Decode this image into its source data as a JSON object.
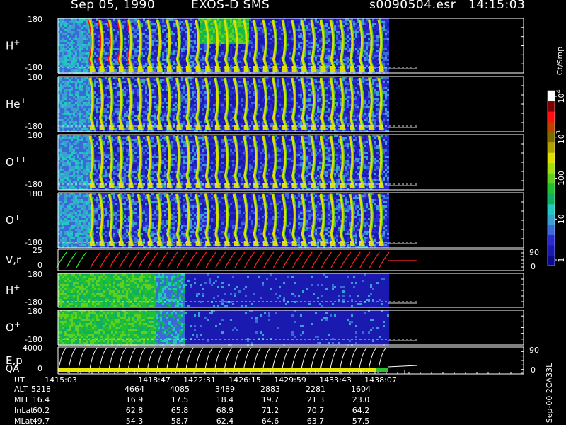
{
  "header": {
    "date": "Sep 05, 1990",
    "instrument": "EXOS-D SMS",
    "file": "s0090504.esr",
    "time": "14:15:03"
  },
  "chart_data": {
    "type": "heatmap",
    "panels": [
      {
        "label": "H",
        "charge": "+",
        "ytop": "180",
        "ybottom": "-180"
      },
      {
        "label": "He",
        "charge": "+",
        "ytop": "180",
        "ybottom": "-180"
      },
      {
        "label": "O",
        "charge": "++",
        "ytop": "180",
        "ybottom": "-180"
      },
      {
        "label": "O",
        "charge": "+",
        "ytop": "180",
        "ybottom": "-180"
      },
      {
        "label": "V,r",
        "charge": "",
        "ytop": "25",
        "ybottom": "0",
        "right_top": "90",
        "right_bottom": "0"
      },
      {
        "label": "H",
        "charge": "+",
        "ytop": "180",
        "ybottom": "-180"
      },
      {
        "label": "O",
        "charge": "+",
        "ytop": "180",
        "ybottom": "-180"
      },
      {
        "label": "E,p",
        "charge": "",
        "ytop": "4000",
        "ybottom": "0",
        "right_top": "90",
        "right_bottom": "0"
      }
    ],
    "qa_label": "QA",
    "colorbar": {
      "unit": "Ct/Smp",
      "ticks": [
        {
          "label": "1",
          "value": 1
        },
        {
          "label": "10",
          "value": 10
        },
        {
          "label": "100",
          "value": 100
        },
        {
          "label": "10",
          "exp": "3",
          "value": 1000
        },
        {
          "label": "10",
          "exp": "4",
          "value": 10000
        }
      ],
      "colors": [
        "#0a0a8c",
        "#1a1ab0",
        "#2a2ad0",
        "#3a6ad8",
        "#3aa0d0",
        "#20c8c0",
        "#10b060",
        "#20c030",
        "#60d020",
        "#a0e010",
        "#e0e000",
        "#b0a000",
        "#806a00",
        "#c04000",
        "#ff1010",
        "#800000",
        "#ffffff"
      ]
    },
    "x_ticks": [
      "1415:03",
      "1418:47",
      "1422:31",
      "1426:15",
      "1429:59",
      "1433:43",
      "1438:07"
    ],
    "orbit_rows": [
      {
        "label": "UT",
        "values": [
          "1415:03",
          "1418:47",
          "1422:31",
          "1426:15",
          "1429:59",
          "1433:43",
          "1438:07"
        ]
      },
      {
        "label": "ALT",
        "values": [
          "5218",
          "4664",
          "4085",
          "3489",
          "2883",
          "2281",
          "1604"
        ]
      },
      {
        "label": "MLT",
        "values": [
          "16.4",
          "16.9",
          "17.5",
          "18.4",
          "19.7",
          "21.3",
          "23.0"
        ]
      },
      {
        "label": "InLat",
        "values": [
          "60.2",
          "62.8",
          "65.8",
          "68.9",
          "71.2",
          "70.7",
          "64.2"
        ]
      },
      {
        "label": "MLat",
        "values": [
          "49.7",
          "54.3",
          "58.7",
          "62.4",
          "64.6",
          "63.7",
          "57.5"
        ]
      }
    ],
    "footer": "Sep-00  2CA33L"
  }
}
